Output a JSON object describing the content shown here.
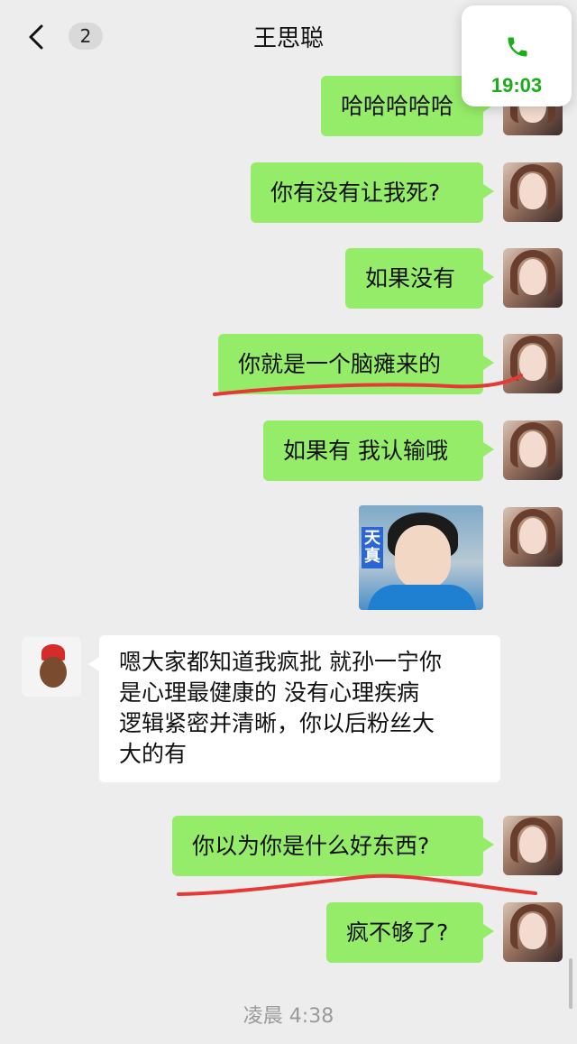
{
  "header": {
    "back_count": "2",
    "title": "王思聪"
  },
  "call": {
    "time": "19:03",
    "icon": "phone-icon",
    "color": "#1aad19"
  },
  "messages": [
    {
      "dir": "out",
      "text": "哈哈哈哈哈"
    },
    {
      "dir": "out",
      "text": "你有没有让我死?"
    },
    {
      "dir": "out",
      "text": "如果没有"
    },
    {
      "dir": "out",
      "text": "你就是一个脑瘫来的"
    },
    {
      "dir": "out",
      "text": "如果有 我认输哦"
    },
    {
      "dir": "out",
      "type": "sticker",
      "caption": "天真"
    },
    {
      "dir": "in",
      "lines": [
        "嗯大家都知道我疯批 就孙一宁你",
        "是心理最健康的 没有心理疾病",
        "逻辑紧密并清晰，你以后粉丝大",
        "大的有"
      ]
    },
    {
      "dir": "out",
      "text": "你以为你是什么好东西?"
    },
    {
      "dir": "out",
      "text": "疯不够了?"
    }
  ],
  "timestamp": "凌晨 4:38",
  "colors": {
    "background": "#ededed",
    "outgoing_bubble": "#95ec69",
    "incoming_bubble": "#ffffff",
    "annotation_underline": "#e53935"
  }
}
